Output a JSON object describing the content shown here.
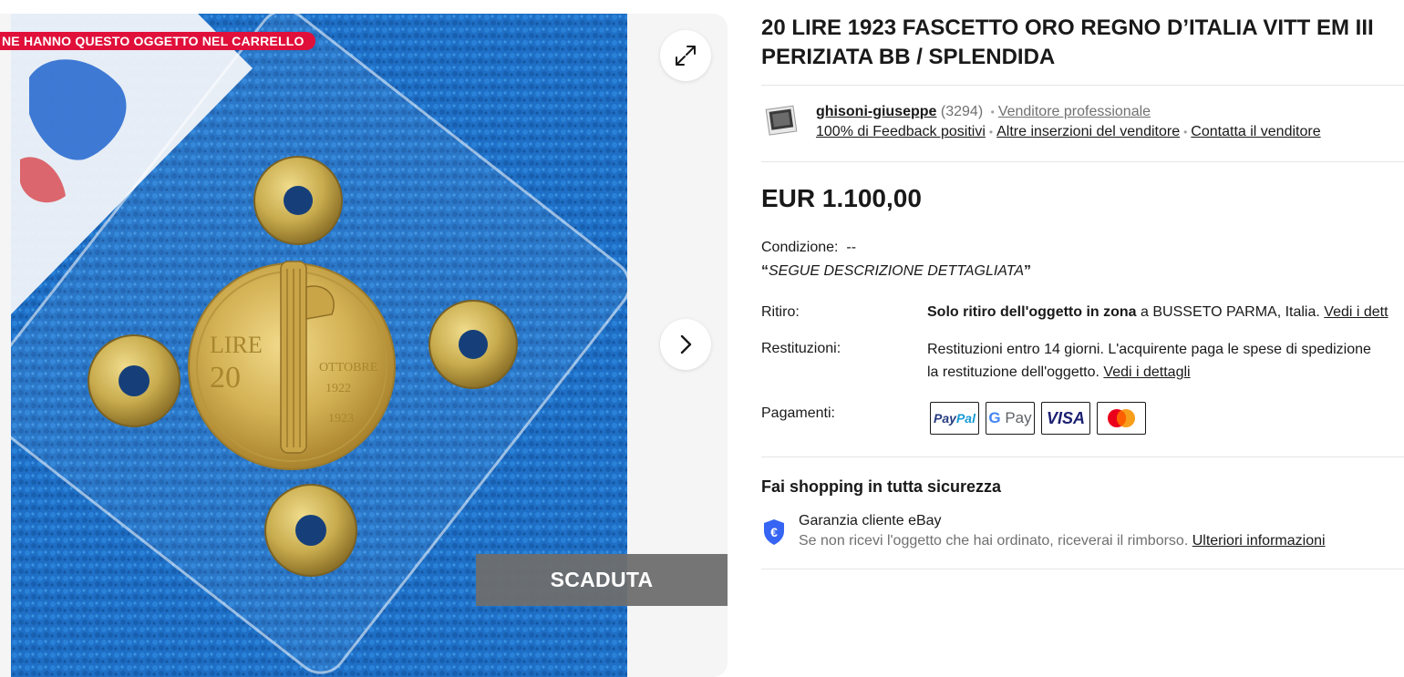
{
  "gallery": {
    "cart_banner": "NE HANNO QUESTO OGGETTO NEL CARRELLO",
    "status_overlay": "SCADUTA",
    "expand_icon": "expand-arrows-icon",
    "next_icon": "chevron-right-icon"
  },
  "item": {
    "title_line1": "20 LIRE 1923 FASCETTO ORO REGNO D’ITALIA VITT EM III",
    "title_line2": "PERIZIATA BB / SPLENDIDA"
  },
  "seller": {
    "name": "ghisoni-giuseppe",
    "score": "(3294)",
    "type": "Venditore professionale",
    "feedback": "100% di Feedback positivi",
    "other_listings": "Altre inserzioni del venditore",
    "contact": "Contatta il venditore"
  },
  "price": "EUR 1.100,00",
  "condition": {
    "label": "Condizione:",
    "value": "--",
    "open_quote": "“",
    "note": "SEGUE DESCRIZIONE DETTAGLIATA",
    "close_quote": "”"
  },
  "pickup": {
    "label": "Ritiro:",
    "bold": "Solo ritiro dell'oggetto in zona",
    "text": " a BUSSETO PARMA, Italia. ",
    "link": "Vedi i dett"
  },
  "returns": {
    "label": "Restituzioni:",
    "line1": "Restituzioni entro 14 giorni. L'acquirente paga le spese di spedizione",
    "line2": "la restituzione dell'oggetto. ",
    "link": "Vedi i dettagli"
  },
  "payments": {
    "label": "Pagamenti:",
    "methods": [
      "PayPal",
      "G Pay",
      "VISA",
      "mastercard"
    ]
  },
  "safety": {
    "title": "Fai shopping in tutta sicurezza",
    "guarantee_title": "Garanzia cliente eBay",
    "guarantee_text": "Se non ricevi l'oggetto che hai ordinato, riceverai il rimborso. ",
    "guarantee_link": "Ulteriori informazioni",
    "icon": "euro-shield-icon"
  },
  "colors": {
    "banner_red": "#e0103a",
    "overlay_gray": "#6e6e6e",
    "shield_blue": "#3665f3",
    "photo_blue": "#1d6fc4"
  }
}
